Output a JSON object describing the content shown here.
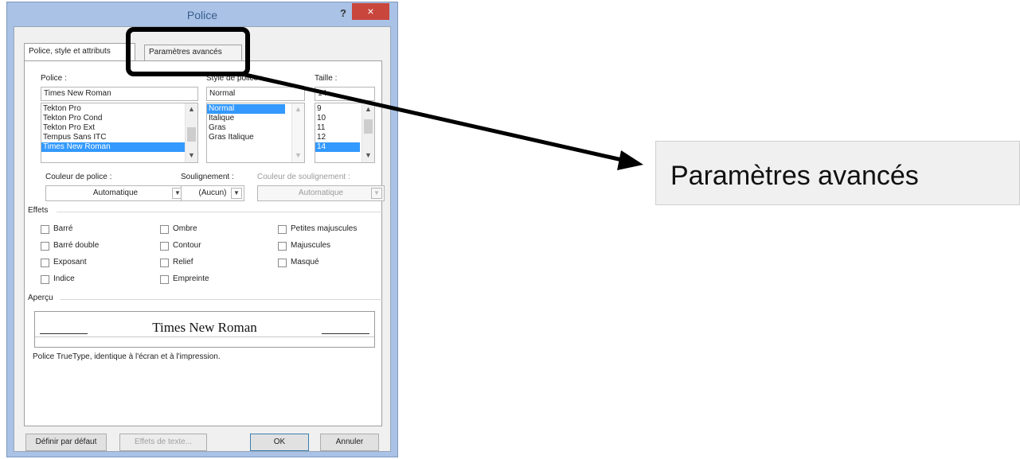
{
  "window": {
    "title": "Police",
    "help": "?",
    "close": "×"
  },
  "tabs": [
    {
      "label": "Police, style et attributs"
    },
    {
      "label": "Paramètres avancés"
    }
  ],
  "font": {
    "label": "Police :",
    "value": "Times New Roman",
    "list": [
      "Tekton Pro",
      "Tekton Pro Cond",
      "Tekton Pro Ext",
      "Tempus Sans ITC",
      "Times New Roman"
    ],
    "selected": "Times New Roman"
  },
  "style": {
    "label": "Style de police :",
    "value": "Normal",
    "list": [
      "Normal",
      "Italique",
      "Gras",
      "Gras Italique"
    ],
    "selected": "Normal"
  },
  "size": {
    "label": "Taille :",
    "value": "14",
    "list": [
      "9",
      "10",
      "11",
      "12",
      "14"
    ],
    "selected": "14"
  },
  "font_color": {
    "label": "Couleur de police :",
    "value": "Automatique"
  },
  "underline": {
    "label": "Soulignement :",
    "value": "(Aucun)"
  },
  "underline_color": {
    "label": "Couleur de soulignement :",
    "value": "Automatique"
  },
  "effects": {
    "label": "Effets",
    "items": [
      "Barré",
      "Barré double",
      "Exposant",
      "Indice",
      "Ombre",
      "Contour",
      "Relief",
      "Empreinte",
      "Petites majuscules",
      "Majuscules",
      "Masqué"
    ]
  },
  "preview": {
    "label": "Aperçu",
    "text": "Times New Roman",
    "note": "Police TrueType, identique à l'écran et à l'impression."
  },
  "buttons": {
    "default": "Définir par défaut",
    "text_effects": "Effets de texte...",
    "ok": "OK",
    "cancel": "Annuler"
  },
  "callout": {
    "text": "Paramètres avancés"
  }
}
